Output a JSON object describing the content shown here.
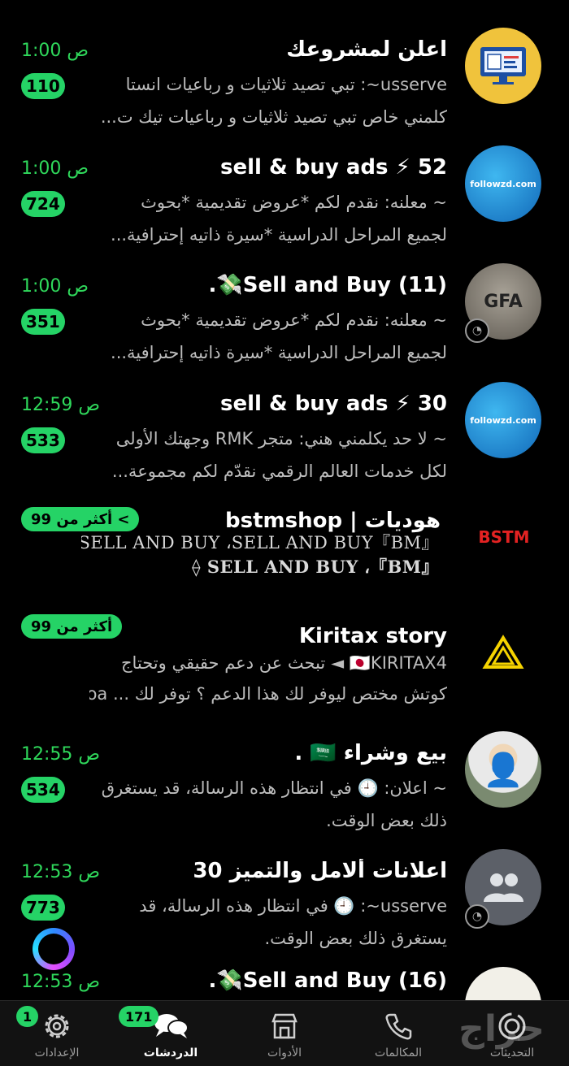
{
  "chats": [
    {
      "title": "اعلن لمشروعك",
      "time": "1:00 ص",
      "badge": "110",
      "preview1": "usserve~: تبي تصيد ثلاثيات و رباعيات انستا",
      "preview2": "كلمني خاص تبي تصيد ثلاثيات و رباعيات تيك ت..."
    },
    {
      "title": "52 ⚡ sell & buy ads",
      "time": "1:00 ص",
      "badge": "724",
      "preview1": "~ معلنه: نقدم لكم *عروض تقديمية   *بحوث",
      "preview2": "لجميع المراحل الدراسية *سيرة ذاتيه إحترافية..."
    },
    {
      "title": "Sell and Buy (11)💸.",
      "time": "1:00 ص",
      "badge": "351",
      "preview1": "~ معلنه: نقدم لكم *عروض تقديمية   *بحوث",
      "preview2": "لجميع المراحل الدراسية *سيرة ذاتيه إحترافية...",
      "avatar_text": "GFA"
    },
    {
      "title": "30 ⚡ sell & buy ads",
      "time": "12:59 ص",
      "badge": "533",
      "preview1": "~ لا حد يكلمني هني: متجر RMK وجهتك الأولى",
      "preview2": "لكل خدمات العالم الرقمي نقدّم لكم مجموعة..."
    },
    {
      "title": "هوديات | bstmshop",
      "badge": "أكثر من 99 <",
      "preview1": "『BM』SELL AND BUY ،SELL AND BUY",
      "preview2": "『BM』، SELL AND BUY ⟠",
      "avatar_text": "BSTM"
    },
    {
      "title": "Kiritax story",
      "badge": "أكثر من 99",
      "preview1": "🇯🇵KIRITAX4 ◄ تبحث عن دعم حقيقي وتحتاج",
      "preview2": "كوتش مختص ليوفر لك هذا الدعم ؟  توفر لك ... Coa"
    },
    {
      "title": "بيع وشراء 🇸🇦 .",
      "time": "12:55 ص",
      "badge": "534",
      "preview1": "~ اعلان: 🕘 في انتظار هذه الرسالة، قد يستغرق",
      "preview2": "ذلك بعض الوقت."
    },
    {
      "title": "اعلانات ألامل والتميز 30",
      "time": "12:53 ص",
      "badge": "773",
      "preview1": "usserve~: 🕘 في انتظار هذه الرسالة، قد",
      "preview2": "يستغرق ذلك بعض الوقت."
    },
    {
      "title": "Sell and Buy (16)💸.",
      "time": "12:53 ص"
    }
  ],
  "avatar_labels": {
    "followzd": "followzd.com"
  },
  "tabs": [
    {
      "label": "التحديثات",
      "icon": "status-icon"
    },
    {
      "label": "المكالمات",
      "icon": "phone-icon"
    },
    {
      "label": "الأدوات",
      "icon": "store-icon"
    },
    {
      "label": "الدردشات",
      "icon": "chats-icon",
      "badge": "171",
      "active": true
    },
    {
      "label": "الإعدادات",
      "icon": "gear-icon",
      "badge": "1"
    }
  ],
  "watermark": "حراج",
  "colors": {
    "accent": "#25d366",
    "time_green": "#2fd85b",
    "background": "#000000"
  }
}
